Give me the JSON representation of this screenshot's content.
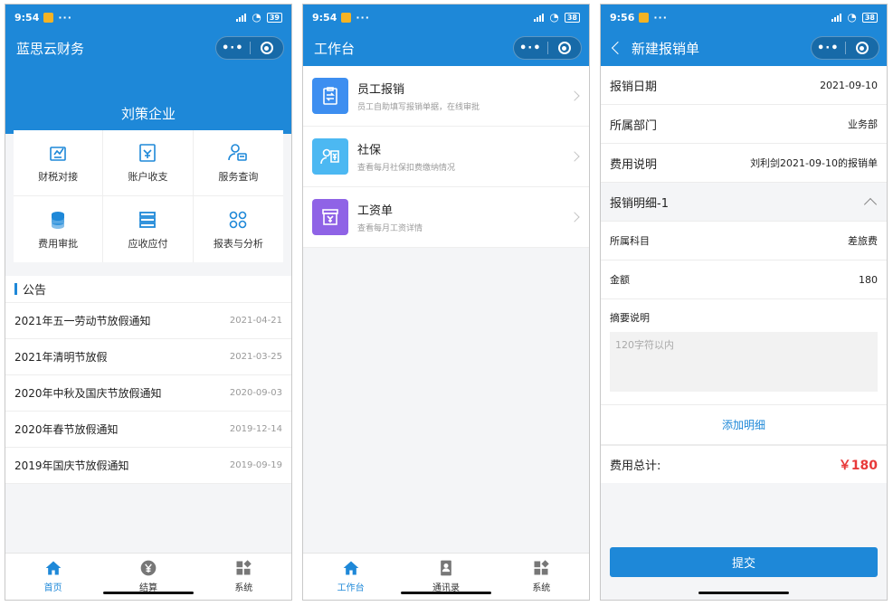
{
  "phone1": {
    "status": {
      "time": "9:54",
      "battery": "39"
    },
    "nav_title": "蓝思云财务",
    "company": "刘策企业",
    "grid": [
      {
        "label": "财税对接",
        "icon": "tax-doc-icon"
      },
      {
        "label": "账户收支",
        "icon": "account-icon"
      },
      {
        "label": "服务查询",
        "icon": "service-user-icon"
      },
      {
        "label": "费用审批",
        "icon": "coins-icon"
      },
      {
        "label": "应收应付",
        "icon": "receivable-icon"
      },
      {
        "label": "报表与分析",
        "icon": "report-grid-icon"
      }
    ],
    "notice_title": "公告",
    "notices": [
      {
        "title": "2021年五一劳动节放假通知",
        "date": "2021-04-21"
      },
      {
        "title": "2021年清明节放假",
        "date": "2021-03-25"
      },
      {
        "title": "2020年中秋及国庆节放假通知",
        "date": "2020-09-03"
      },
      {
        "title": "2020年春节放假通知",
        "date": "2019-12-14"
      },
      {
        "title": "2019年国庆节放假通知",
        "date": "2019-09-19"
      }
    ],
    "tabs": [
      "首页",
      "结算",
      "系统"
    ]
  },
  "phone2": {
    "status": {
      "time": "9:54",
      "battery": "38"
    },
    "nav_title": "工作台",
    "items": [
      {
        "title": "员工报销",
        "sub": "员工自助填写报销单据，在线审批",
        "color": "#3d8ef0"
      },
      {
        "title": "社保",
        "sub": "查看每月社保扣费缴纳情况",
        "color": "#4cb8f2"
      },
      {
        "title": "工资单",
        "sub": "查看每月工资详情",
        "color": "#8f63e6"
      }
    ],
    "tabs": [
      "工作台",
      "通讯录",
      "系统"
    ]
  },
  "phone3": {
    "status": {
      "time": "9:56",
      "battery": "38"
    },
    "nav_title": "新建报销单",
    "date_label": "报销日期",
    "date_value": "2021-09-10",
    "dept_label": "所属部门",
    "dept_value": "业务部",
    "desc_label": "费用说明",
    "desc_value": "刘利剑2021-09-10的报销单",
    "detail_title": "报销明细-1",
    "subject_label": "所属科目",
    "subject_value": "差旅费",
    "amount_label": "金额",
    "amount_value": "180",
    "summary_label": "摘要说明",
    "summary_placeholder": "120字符以内",
    "add_label": "添加明细",
    "total_label": "费用总计:",
    "total_value": "￥180",
    "submit_label": "提交"
  },
  "colors": {
    "primary": "#1e88d8",
    "danger": "#e83a3a"
  }
}
